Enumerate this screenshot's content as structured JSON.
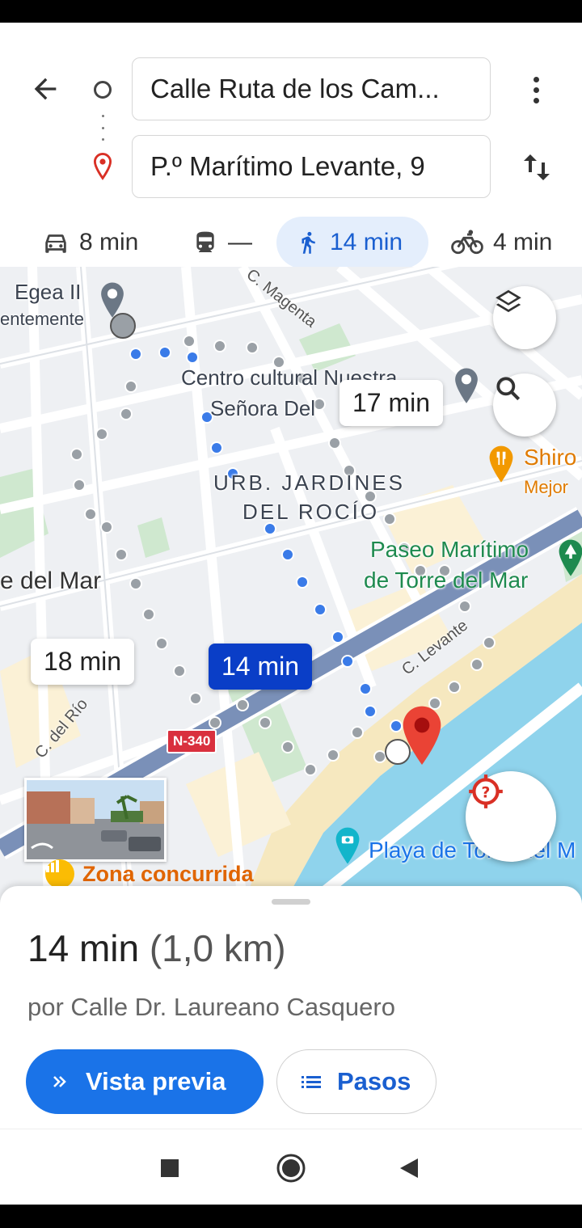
{
  "header": {
    "origin": "Calle Ruta de los Cam...",
    "destination": "P.º Marítimo Levante, 9"
  },
  "modes": [
    {
      "name": "car",
      "label": "8 min"
    },
    {
      "name": "transit",
      "label": "—"
    },
    {
      "name": "walk",
      "label": "14 min",
      "selected": true
    },
    {
      "name": "bike",
      "label": "4 min"
    }
  ],
  "map": {
    "labels": {
      "place_egea": "Egea II",
      "place_egea_sub": "entemente",
      "centro_line1": "Centro cultural Nuestra",
      "centro_line2": "Señora Del",
      "urb_line1": "URB. JARDINES",
      "urb_line2": "DEL ROCÍO",
      "shiro": "Shiro",
      "shiro_sub": "Mejor",
      "paseo_line1": "Paseo Marítimo",
      "paseo_line2": "de Torre del Mar",
      "del_mar": "e del Mar",
      "playa": "Playa de Torre del M",
      "road_magenta": "C. Magenta",
      "road_levante": "C. Levante",
      "road_rio": "C. del Río",
      "highway": "N-340"
    },
    "route_bubbles": {
      "selected": "14 min",
      "alt1": "17 min",
      "alt2": "18 min"
    },
    "busy_label": "Zona concurrida",
    "colors": {
      "route": "#3a7be8",
      "alt_route": "#9aa0a6",
      "water": "#8fd3ec",
      "beach": "#f6e8bf",
      "park": "#cfe8cf",
      "highway": "#7a90b8"
    }
  },
  "sheet": {
    "duration": "14 min",
    "distance": "(1,0 km)",
    "via": "por Calle Dr. Laureano Casquero",
    "preview_label": "Vista previa",
    "steps_label": "Pasos"
  }
}
